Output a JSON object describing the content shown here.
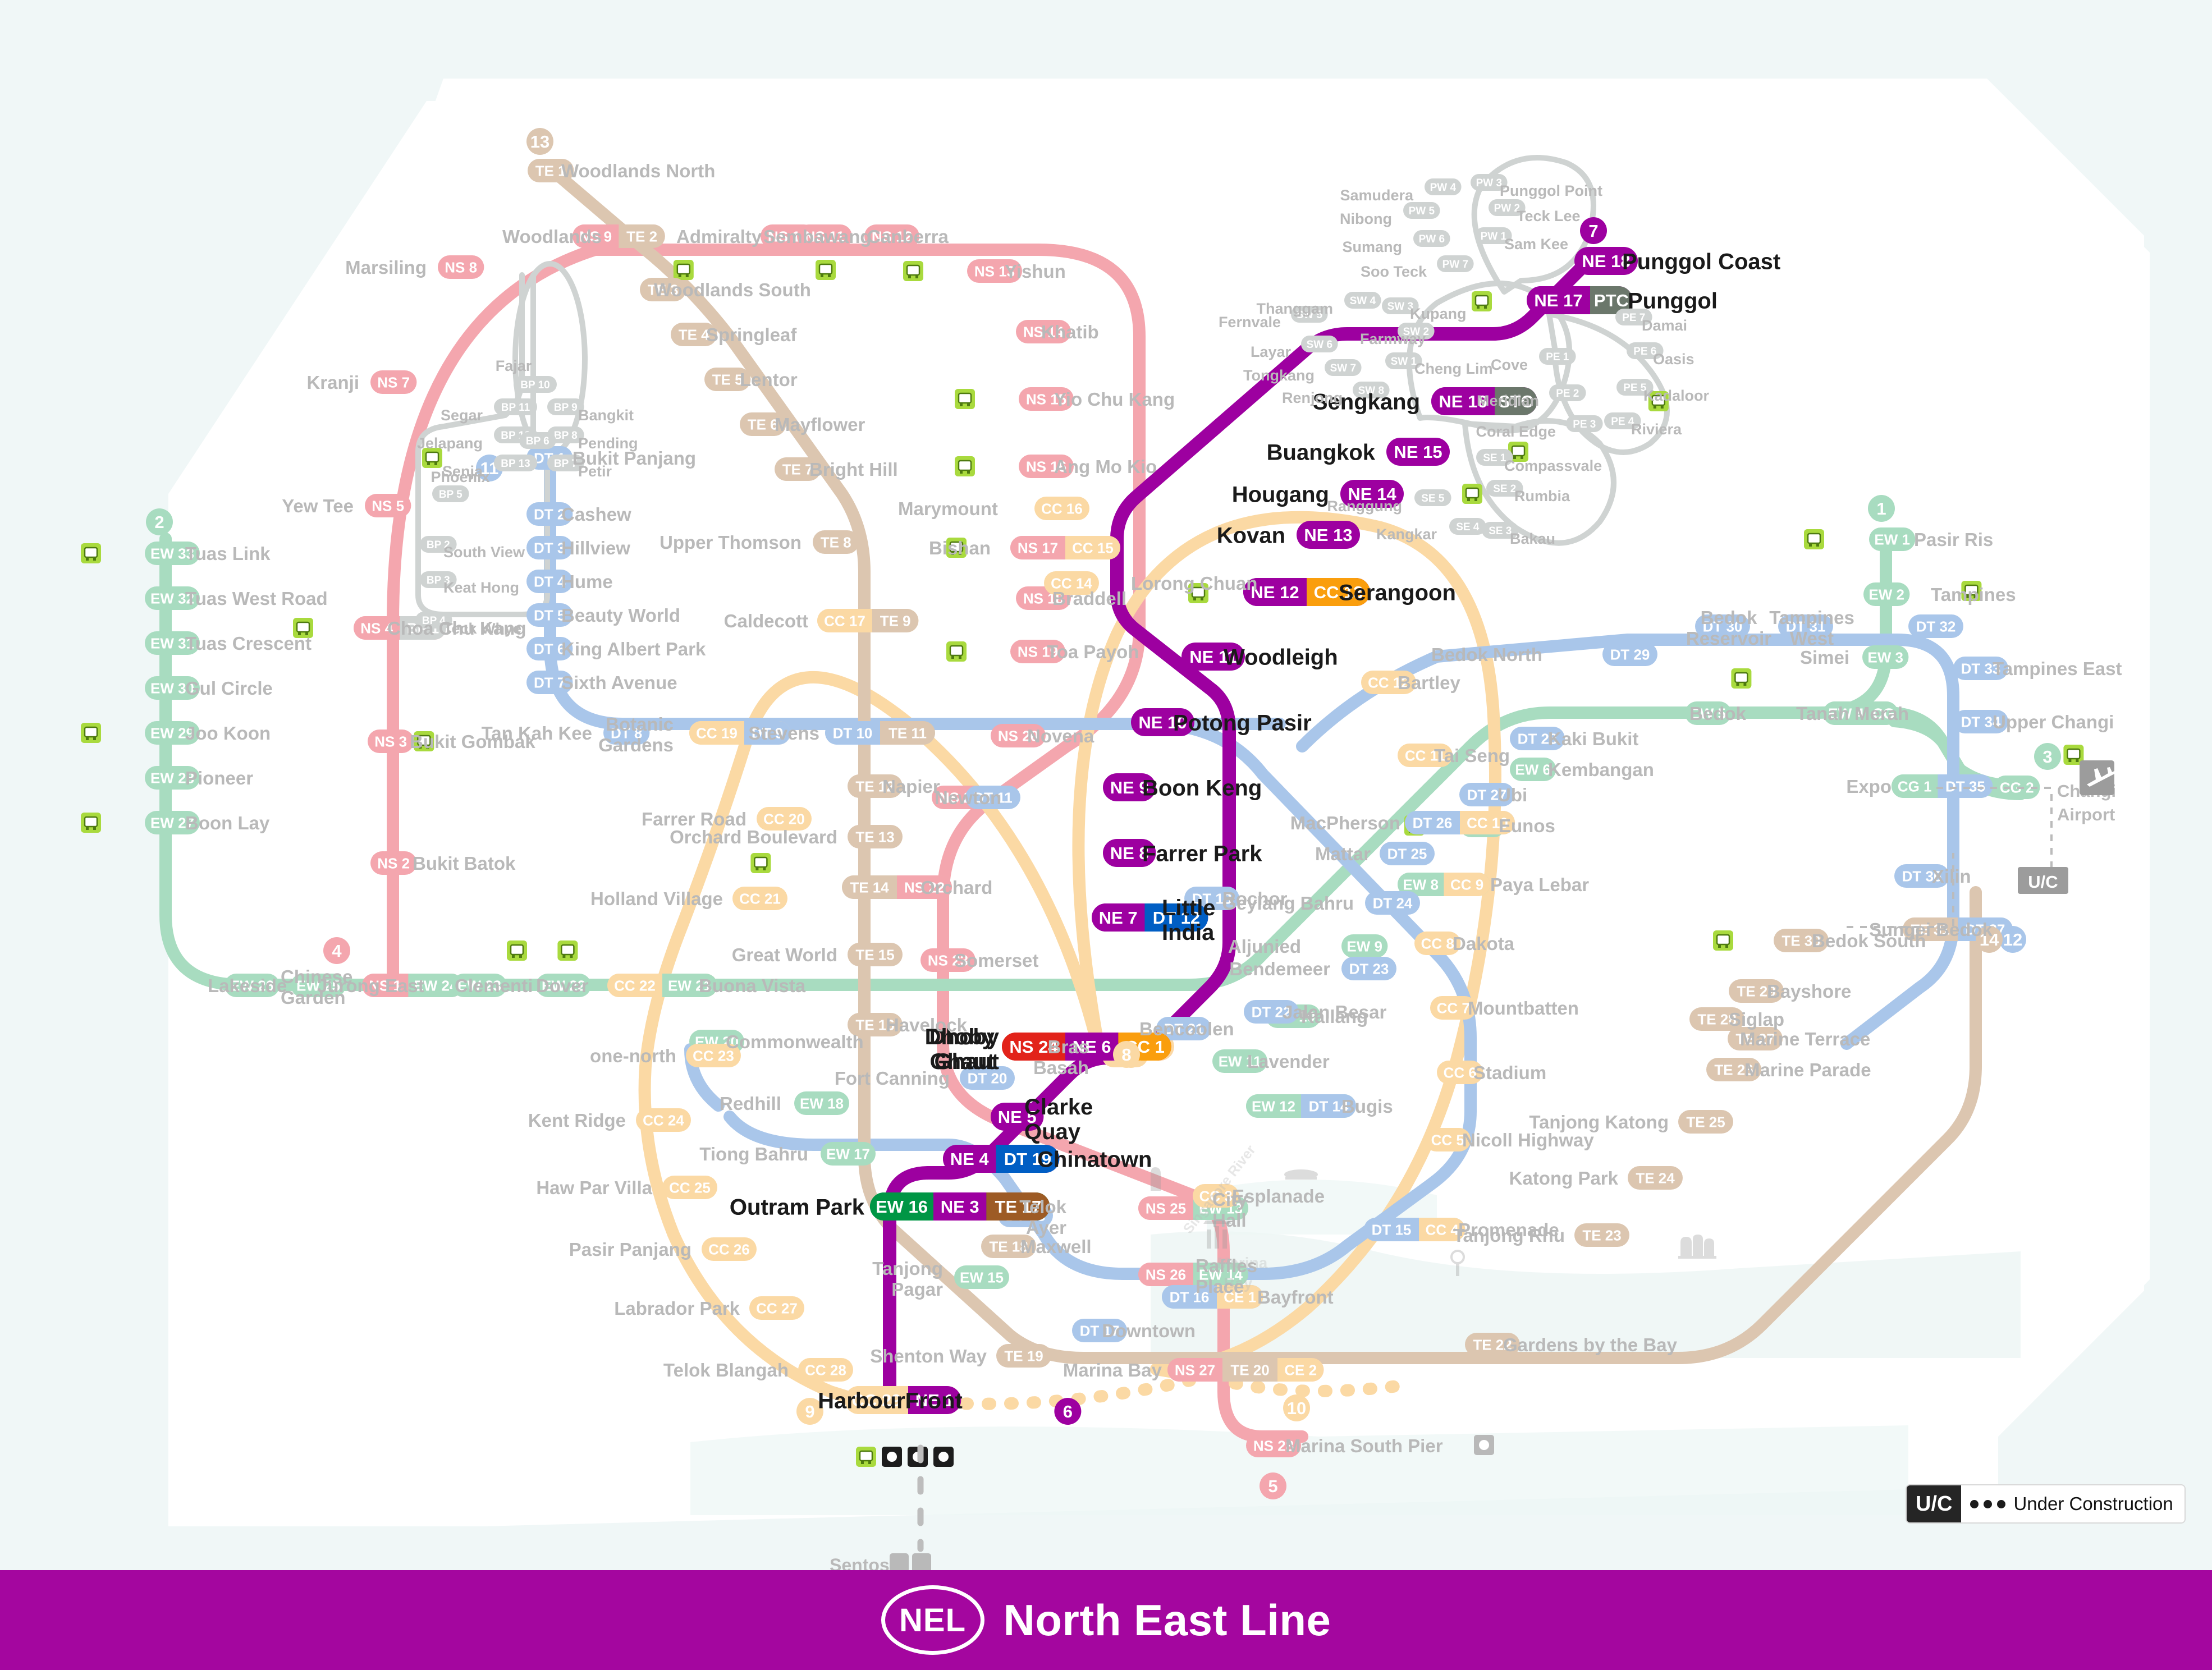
{
  "footer": {
    "line_code": "NEL",
    "line_name": "North East Line",
    "bg_color": "#A4069F"
  },
  "legend": {
    "uc_badge": "U/C",
    "uc_text": "Under Construction"
  },
  "colors": {
    "nel": "#9D00A0",
    "nel_dim": "#9D00A0",
    "ns": "#F4A6AE",
    "ew": "#A8DCC0",
    "cc": "#FBD9A4",
    "dt": "#A9C6EA",
    "te": "#DCC6B0",
    "lrt": "#CFD3D2",
    "bus_green": "#A9DA3E",
    "label_dim": "#b9b9b9",
    "label_nel": "#1a1a1a",
    "water": "#EDF6F5"
  },
  "highlighted_line": {
    "code": "NEL",
    "name": "North East Line",
    "stations": [
      {
        "code": "NE 1",
        "name": "HarbourFront",
        "interchange": [
          "CC 29"
        ],
        "circle": "9",
        "endcircle": "6",
        "facilities": [
          "bus",
          "ferry",
          "monorail",
          "cablecar"
        ]
      },
      {
        "code": "NE 3",
        "name": "Outram Park",
        "interchange": [
          "EW 16",
          "TE 17"
        ]
      },
      {
        "code": "NE 4",
        "name": "Chinatown",
        "interchange": [
          "DT 19"
        ]
      },
      {
        "code": "NE 5",
        "name": "Clarke Quay",
        "interchange": []
      },
      {
        "code": "NE 6",
        "name": "Dhoby Ghaut",
        "interchange": [
          "NS 24",
          "CC 1"
        ],
        "circle": "8"
      },
      {
        "code": "NE 7",
        "name": "Little India",
        "interchange": [
          "DT 12"
        ]
      },
      {
        "code": "NE 8",
        "name": "Farrer Park",
        "interchange": []
      },
      {
        "code": "NE 9",
        "name": "Boon Keng",
        "interchange": []
      },
      {
        "code": "NE 10",
        "name": "Potong Pasir",
        "interchange": []
      },
      {
        "code": "NE 11",
        "name": "Woodleigh",
        "interchange": []
      },
      {
        "code": "NE 12",
        "name": "Serangoon",
        "interchange": [
          "CC 13"
        ],
        "facilities": [
          "bus"
        ]
      },
      {
        "code": "NE 13",
        "name": "Kovan",
        "interchange": []
      },
      {
        "code": "NE 14",
        "name": "Hougang",
        "interchange": [],
        "facilities": [
          "bus"
        ]
      },
      {
        "code": "NE 15",
        "name": "Buangkok",
        "interchange": [],
        "facilities": [
          "bus"
        ]
      },
      {
        "code": "NE 16",
        "name": "Sengkang",
        "interchange": [
          "STC"
        ],
        "facilities": [
          "bus"
        ]
      },
      {
        "code": "NE 17",
        "name": "Punggol",
        "interchange": [
          "PTC"
        ],
        "facilities": [
          "bus"
        ]
      },
      {
        "code": "NE 18",
        "name": "Punggol Coast",
        "interchange": [],
        "circle": "7"
      }
    ]
  },
  "other_lines": {
    "north_south": {
      "color": "#F4A6AE",
      "stations": [
        {
          "code": "NS 1",
          "name": "Jurong East",
          "circle": "4"
        },
        {
          "code": "NS 2",
          "name": "Bukit Batok"
        },
        {
          "code": "NS 3",
          "name": "Bukit Gombak"
        },
        {
          "code": "NS 4",
          "name": "Choa Chu Kang"
        },
        {
          "code": "NS 5",
          "name": "Yew Tee"
        },
        {
          "code": "NS 7",
          "name": "Kranji"
        },
        {
          "code": "NS 8",
          "name": "Marsiling"
        },
        {
          "code": "NS 9",
          "name": "Woodlands"
        },
        {
          "code": "NS 10",
          "name": "Admiralty"
        },
        {
          "code": "NS 11",
          "name": "Sembawang"
        },
        {
          "code": "NS 12",
          "name": "Canberra"
        },
        {
          "code": "NS 13",
          "name": "Yishun"
        },
        {
          "code": "NS 14",
          "name": "Khatib"
        },
        {
          "code": "NS 15",
          "name": "Yio Chu Kang"
        },
        {
          "code": "NS 16",
          "name": "Ang Mo Kio"
        },
        {
          "code": "NS 17",
          "name": "Bishan"
        },
        {
          "code": "NS 18",
          "name": "Braddell"
        },
        {
          "code": "NS 19",
          "name": "Toa Payoh"
        },
        {
          "code": "NS 20",
          "name": "Novena"
        },
        {
          "code": "NS 21",
          "name": "Newton"
        },
        {
          "code": "NS 22",
          "name": "Orchard"
        },
        {
          "code": "NS 23",
          "name": "Somerset"
        },
        {
          "code": "NS 24",
          "name": "Dhoby Ghaut"
        },
        {
          "code": "NS 25",
          "name": "City Hall"
        },
        {
          "code": "NS 26",
          "name": "Raffles Place"
        },
        {
          "code": "NS 27",
          "name": "Marina Bay"
        },
        {
          "code": "NS 28",
          "name": "Marina South Pier",
          "circle": "5"
        }
      ]
    },
    "east_west": {
      "color": "#A8DCC0",
      "stations": [
        {
          "code": "EW 1",
          "name": "Pasir Ris",
          "circle": "1"
        },
        {
          "code": "EW 2",
          "name": "Tampines"
        },
        {
          "code": "EW 3",
          "name": "Simei"
        },
        {
          "code": "EW 4",
          "name": "Tanah Merah"
        },
        {
          "code": "EW 5",
          "name": "Bedok"
        },
        {
          "code": "EW 6",
          "name": "Kembangan"
        },
        {
          "code": "EW 7",
          "name": "Eunos"
        },
        {
          "code": "EW 8",
          "name": "Paya Lebar"
        },
        {
          "code": "EW 9",
          "name": "Aljunied"
        },
        {
          "code": "EW 10",
          "name": "Kallang"
        },
        {
          "code": "EW 11",
          "name": "Lavender"
        },
        {
          "code": "EW 12",
          "name": "Bugis"
        },
        {
          "code": "EW 13",
          "name": "City Hall"
        },
        {
          "code": "EW 14",
          "name": "Raffles Place"
        },
        {
          "code": "EW 15",
          "name": "Tanjong Pagar"
        },
        {
          "code": "EW 16",
          "name": "Outram Park"
        },
        {
          "code": "EW 17",
          "name": "Tiong Bahru"
        },
        {
          "code": "EW 18",
          "name": "Redhill"
        },
        {
          "code": "EW 20",
          "name": "Commonwealth"
        },
        {
          "code": "EW 21",
          "name": "Buona Vista"
        },
        {
          "code": "EW 22",
          "name": "Dover"
        },
        {
          "code": "EW 23",
          "name": "Clementi"
        },
        {
          "code": "EW 24",
          "name": "Jurong East"
        },
        {
          "code": "EW 25",
          "name": "Chinese Garden"
        },
        {
          "code": "EW 26",
          "name": "Lakeside"
        },
        {
          "code": "EW 27",
          "name": "Boon Lay"
        },
        {
          "code": "EW 28",
          "name": "Pioneer"
        },
        {
          "code": "EW 29",
          "name": "Joo Koon"
        },
        {
          "code": "EW 30",
          "name": "Gul Circle"
        },
        {
          "code": "EW 31",
          "name": "Tuas Crescent"
        },
        {
          "code": "EW 32",
          "name": "Tuas West Road"
        },
        {
          "code": "EW 33",
          "name": "Tuas Link",
          "circle": "2"
        },
        {
          "code": "CG 1",
          "name": "Expo"
        },
        {
          "code": "CG 2",
          "name": "Changi Airport",
          "circle": "3"
        }
      ]
    },
    "circle": {
      "color": "#FBD9A4",
      "stations": [
        {
          "code": "CC 1",
          "name": "Dhoby Ghaut"
        },
        {
          "code": "CC 2",
          "name": "Bras Basah"
        },
        {
          "code": "CC 3",
          "name": "Esplanade"
        },
        {
          "code": "CC 4",
          "name": "Promenade"
        },
        {
          "code": "CC 5",
          "name": "Nicoll Highway"
        },
        {
          "code": "CC 6",
          "name": "Stadium"
        },
        {
          "code": "CC 7",
          "name": "Mountbatten"
        },
        {
          "code": "CC 8",
          "name": "Dakota"
        },
        {
          "code": "CC 9",
          "name": "Paya Lebar"
        },
        {
          "code": "CC 10",
          "name": "MacPherson"
        },
        {
          "code": "CC 11",
          "name": "Tai Seng"
        },
        {
          "code": "CC 12",
          "name": "Bartley"
        },
        {
          "code": "CC 13",
          "name": "Serangoon"
        },
        {
          "code": "CC 14",
          "name": "Lorong Chuan"
        },
        {
          "code": "CC 15",
          "name": "Bishan"
        },
        {
          "code": "CC 16",
          "name": "Marymount"
        },
        {
          "code": "CC 17",
          "name": "Caldecott"
        },
        {
          "code": "CC 19",
          "name": "Botanic Gardens"
        },
        {
          "code": "CC 20",
          "name": "Farrer Road"
        },
        {
          "code": "CC 21",
          "name": "Holland Village"
        },
        {
          "code": "CC 22",
          "name": "Buona Vista"
        },
        {
          "code": "CC 23",
          "name": "one-north"
        },
        {
          "code": "CC 24",
          "name": "Kent Ridge"
        },
        {
          "code": "CC 25",
          "name": "Haw Par Villa"
        },
        {
          "code": "CC 26",
          "name": "Pasir Panjang"
        },
        {
          "code": "CC 27",
          "name": "Labrador Park"
        },
        {
          "code": "CC 28",
          "name": "Telok Blangah"
        },
        {
          "code": "CC 29",
          "name": "HarbourFront"
        },
        {
          "code": "CE 1",
          "name": "Bayfront"
        },
        {
          "code": "CE 2",
          "name": "Marina Bay",
          "circle": "10"
        }
      ]
    },
    "downtown": {
      "color": "#A9C6EA",
      "stations": [
        {
          "code": "DT 1",
          "name": "Bukit Panjang",
          "circle": "11"
        },
        {
          "code": "DT 2",
          "name": "Cashew"
        },
        {
          "code": "DT 3",
          "name": "Hillview"
        },
        {
          "code": "DT 4",
          "name": "Hume"
        },
        {
          "code": "DT 5",
          "name": "Beauty World"
        },
        {
          "code": "DT 6",
          "name": "King Albert Park"
        },
        {
          "code": "DT 7",
          "name": "Sixth Avenue"
        },
        {
          "code": "DT 8",
          "name": "Tan Kah Kee"
        },
        {
          "code": "DT 9",
          "name": "Botanic Gardens"
        },
        {
          "code": "DT 10",
          "name": "Stevens"
        },
        {
          "code": "DT 11",
          "name": "Newton"
        },
        {
          "code": "DT 12",
          "name": "Little India"
        },
        {
          "code": "DT 13",
          "name": "Rochor"
        },
        {
          "code": "DT 14",
          "name": "Bugis"
        },
        {
          "code": "DT 15",
          "name": "Promenade"
        },
        {
          "code": "DT 16",
          "name": "Bayfront"
        },
        {
          "code": "DT 17",
          "name": "Downtown"
        },
        {
          "code": "DT 18",
          "name": "Telok Ayer"
        },
        {
          "code": "DT 19",
          "name": "Chinatown"
        },
        {
          "code": "DT 20",
          "name": "Fort Canning"
        },
        {
          "code": "DT 21",
          "name": "Bencoolen"
        },
        {
          "code": "DT 22",
          "name": "Jalan Besar"
        },
        {
          "code": "DT 23",
          "name": "Bendemeer"
        },
        {
          "code": "DT 24",
          "name": "Geylang Bahru"
        },
        {
          "code": "DT 25",
          "name": "Mattar"
        },
        {
          "code": "DT 26",
          "name": "MacPherson"
        },
        {
          "code": "DT 27",
          "name": "Ubi"
        },
        {
          "code": "DT 28",
          "name": "Kaki Bukit"
        },
        {
          "code": "DT 29",
          "name": "Bedok North"
        },
        {
          "code": "DT 30",
          "name": "Bedok Reservoir"
        },
        {
          "code": "DT 31",
          "name": "Tampines West"
        },
        {
          "code": "DT 32",
          "name": "Tampines"
        },
        {
          "code": "DT 33",
          "name": "Tampines East"
        },
        {
          "code": "DT 34",
          "name": "Upper Changi"
        },
        {
          "code": "DT 35",
          "name": "Expo"
        },
        {
          "code": "DT 36",
          "name": "Xilin"
        },
        {
          "code": "DT 37",
          "name": "Sungei Bedok",
          "circle": "12"
        }
      ]
    },
    "thomson_east_coast": {
      "color": "#DCC6B0",
      "stations": [
        {
          "code": "TE 1",
          "name": "Woodlands North",
          "circle": "13"
        },
        {
          "code": "TE 2",
          "name": "Woodlands"
        },
        {
          "code": "TE 3",
          "name": "Woodlands South"
        },
        {
          "code": "TE 4",
          "name": "Springleaf"
        },
        {
          "code": "TE 5",
          "name": "Lentor"
        },
        {
          "code": "TE 6",
          "name": "Mayflower"
        },
        {
          "code": "TE 7",
          "name": "Bright Hill"
        },
        {
          "code": "TE 8",
          "name": "Upper Thomson"
        },
        {
          "code": "TE 9",
          "name": "Caldecott"
        },
        {
          "code": "TE 11",
          "name": "Stevens"
        },
        {
          "code": "TE 12",
          "name": "Napier"
        },
        {
          "code": "TE 13",
          "name": "Orchard Boulevard"
        },
        {
          "code": "TE 14",
          "name": "Orchard"
        },
        {
          "code": "TE 15",
          "name": "Great World"
        },
        {
          "code": "TE 16",
          "name": "Havelock"
        },
        {
          "code": "TE 17",
          "name": "Outram Park"
        },
        {
          "code": "TE 18",
          "name": "Maxwell"
        },
        {
          "code": "TE 19",
          "name": "Shenton Way"
        },
        {
          "code": "TE 20",
          "name": "Marina Bay"
        },
        {
          "code": "TE 22",
          "name": "Gardens by the Bay"
        },
        {
          "code": "TE 23",
          "name": "Tanjong Rhu"
        },
        {
          "code": "TE 24",
          "name": "Katong Park"
        },
        {
          "code": "TE 25",
          "name": "Tanjong Katong"
        },
        {
          "code": "TE 26",
          "name": "Marine Parade"
        },
        {
          "code": "TE 27",
          "name": "Marine Terrace"
        },
        {
          "code": "TE 28",
          "name": "Siglap"
        },
        {
          "code": "TE 29",
          "name": "Bayshore"
        },
        {
          "code": "TE 30",
          "name": "Bedok South"
        },
        {
          "code": "TE 31",
          "name": "Sungei Bedok",
          "circle": "14"
        }
      ]
    },
    "bukit_panjang_lrt": {
      "color": "#CFD3D2",
      "stations": [
        {
          "code": "BP 1",
          "name": "Choa Chu Kang"
        },
        {
          "code": "BP 2",
          "name": "South View"
        },
        {
          "code": "BP 3",
          "name": "Keat Hong"
        },
        {
          "code": "BP 4",
          "name": "Teck Whye"
        },
        {
          "code": "BP 5",
          "name": "Phoenix"
        },
        {
          "code": "BP 6",
          "name": "Bukit Panjang"
        },
        {
          "code": "BP 7",
          "name": "Petir"
        },
        {
          "code": "BP 8",
          "name": "Pending"
        },
        {
          "code": "BP 9",
          "name": "Bangkit"
        },
        {
          "code": "BP 10",
          "name": "Fajar"
        },
        {
          "code": "BP 11",
          "name": "Segar"
        },
        {
          "code": "BP 12",
          "name": "Jelapang"
        },
        {
          "code": "BP 13",
          "name": "Senja"
        }
      ]
    },
    "sengkang_lrt": {
      "color": "#CFD3D2",
      "stations": [
        {
          "code": "SW 1",
          "name": "Cheng Lim"
        },
        {
          "code": "SW 2",
          "name": "Farmway"
        },
        {
          "code": "SW 3",
          "name": "Kupang"
        },
        {
          "code": "SW 4",
          "name": "Thanggam"
        },
        {
          "code": "SW 5",
          "name": "Fernvale"
        },
        {
          "code": "SW 6",
          "name": "Layar"
        },
        {
          "code": "SW 7",
          "name": "Tongkang"
        },
        {
          "code": "SW 8",
          "name": "Renjong"
        },
        {
          "code": "SE 1",
          "name": "Compassvale"
        },
        {
          "code": "SE 2",
          "name": "Rumbia"
        },
        {
          "code": "SE 3",
          "name": "Bakau"
        },
        {
          "code": "SE 4",
          "name": "Kangkar"
        },
        {
          "code": "SE 5",
          "name": "Ranggung"
        }
      ]
    },
    "punggol_lrt": {
      "color": "#CFD3D2",
      "stations": [
        {
          "code": "PW 1",
          "name": "Sam Kee"
        },
        {
          "code": "PW 2",
          "name": "Teck Lee"
        },
        {
          "code": "PW 3",
          "name": "Punggol Point"
        },
        {
          "code": "PW 4",
          "name": "Samudera"
        },
        {
          "code": "PW 5",
          "name": "Nibong"
        },
        {
          "code": "PW 6",
          "name": "Sumang"
        },
        {
          "code": "PW 7",
          "name": "Soo Teck"
        },
        {
          "code": "PE 1",
          "name": "Cove"
        },
        {
          "code": "PE 2",
          "name": "Meridian"
        },
        {
          "code": "PE 3",
          "name": "Coral Edge"
        },
        {
          "code": "PE 4",
          "name": "Riviera"
        },
        {
          "code": "PE 5",
          "name": "Kadaloor"
        },
        {
          "code": "PE 6",
          "name": "Oasis"
        },
        {
          "code": "PE 7",
          "name": "Damai"
        }
      ]
    }
  },
  "annotations": {
    "changi_airport": "Changi Airport",
    "uc_marker": "U/C",
    "sentosa": "Sentosa",
    "marina_bay_water": "Marina Bay",
    "singapore_river": "Singapore River"
  }
}
